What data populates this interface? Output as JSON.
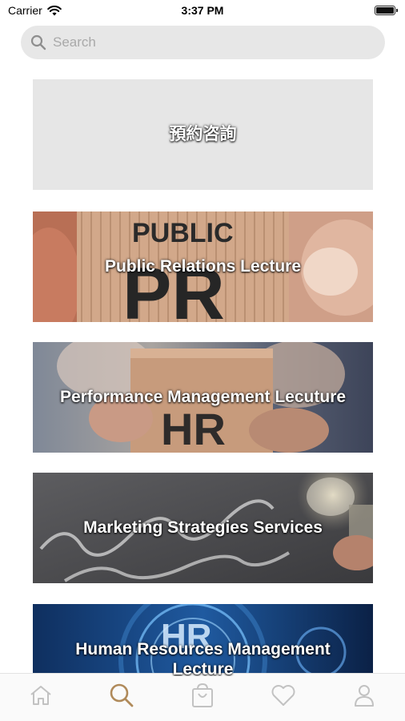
{
  "status_bar": {
    "carrier": "Carrier",
    "time": "3:37 PM",
    "icons": [
      "wifi-icon",
      "battery-icon"
    ]
  },
  "search": {
    "placeholder": "Search",
    "value": "",
    "icon": "search-icon"
  },
  "list": {
    "items": [
      {
        "label": "預約咨詢"
      },
      {
        "label": "Public Relations Lecture"
      },
      {
        "label": "Performance Management Lecuture"
      },
      {
        "label": "Marketing Strategies Services"
      },
      {
        "label": "Human Resources Management Lecture"
      }
    ]
  },
  "tab_bar": {
    "tabs": [
      {
        "icon": "home-icon",
        "active": false
      },
      {
        "icon": "search-icon",
        "active": true
      },
      {
        "icon": "shopping-bag-icon",
        "active": false
      },
      {
        "icon": "heart-icon",
        "active": false
      },
      {
        "icon": "profile-icon",
        "active": false
      }
    ],
    "colors": {
      "active": "#b08a5a",
      "inactive": "#c2c2c2"
    }
  }
}
